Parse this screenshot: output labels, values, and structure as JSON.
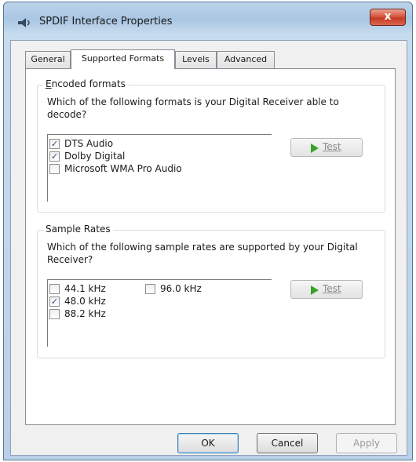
{
  "window": {
    "title": "SPDIF Interface Properties",
    "close_glyph": "x"
  },
  "tabs": [
    {
      "label": "General",
      "selected": false
    },
    {
      "label": "Supported Formats",
      "selected": true
    },
    {
      "label": "Levels",
      "selected": false
    },
    {
      "label": "Advanced",
      "selected": false
    }
  ],
  "encoded_formats": {
    "legend": "Encoded formats",
    "question": "Which of the following formats is your Digital Receiver able to decode?",
    "items": [
      {
        "label": "DTS Audio",
        "checked": true
      },
      {
        "label": "Dolby Digital",
        "checked": true
      },
      {
        "label": "Microsoft WMA Pro Audio",
        "checked": false
      }
    ],
    "test_label": "Test"
  },
  "sample_rates": {
    "legend": "Sample Rates",
    "question": "Which of the following sample rates are supported by your Digital Receiver?",
    "items": [
      {
        "label": "44.1 kHz",
        "checked": false
      },
      {
        "label": "48.0 kHz",
        "checked": true
      },
      {
        "label": "88.2 kHz",
        "checked": false
      },
      {
        "label": "96.0 kHz",
        "checked": false
      }
    ],
    "test_label": "Test"
  },
  "buttons": {
    "ok": "OK",
    "cancel": "Cancel",
    "apply": "Apply"
  },
  "check_glyph": "✓",
  "colors": {
    "play_icon": "#3aa12d",
    "close_button": "#c53a22"
  }
}
